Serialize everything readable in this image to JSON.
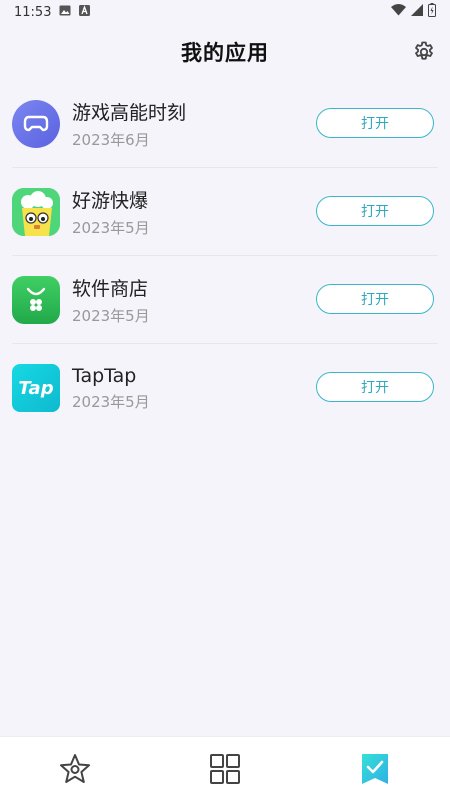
{
  "status_bar": {
    "time": "11:53",
    "icons": [
      "image-icon",
      "a-letter-icon",
      "wifi-icon",
      "signal-icon",
      "battery-icon"
    ]
  },
  "header": {
    "title": "我的应用",
    "settings_icon": "gear-icon"
  },
  "colors": {
    "accent": "#3bb6c8",
    "background": "#f4f4fa"
  },
  "apps": [
    {
      "name": "游戏高能时刻",
      "date": "2023年6月",
      "button": "打开",
      "icon": "gamepad-icon"
    },
    {
      "name": "好游快爆",
      "date": "2023年5月",
      "button": "打开",
      "icon": "popcorn-mascot-icon"
    },
    {
      "name": "软件商店",
      "date": "2023年5月",
      "button": "打开",
      "icon": "app-store-bag-icon"
    },
    {
      "name": "TapTap",
      "date": "2023年5月",
      "button": "打开",
      "icon": "taptap-logo-icon",
      "logo_text": "Tap"
    }
  ],
  "bottom_nav": {
    "items": [
      {
        "icon": "star-icon",
        "active": false
      },
      {
        "icon": "grid-icon",
        "active": false
      },
      {
        "icon": "bookmark-check-icon",
        "active": true
      }
    ]
  }
}
